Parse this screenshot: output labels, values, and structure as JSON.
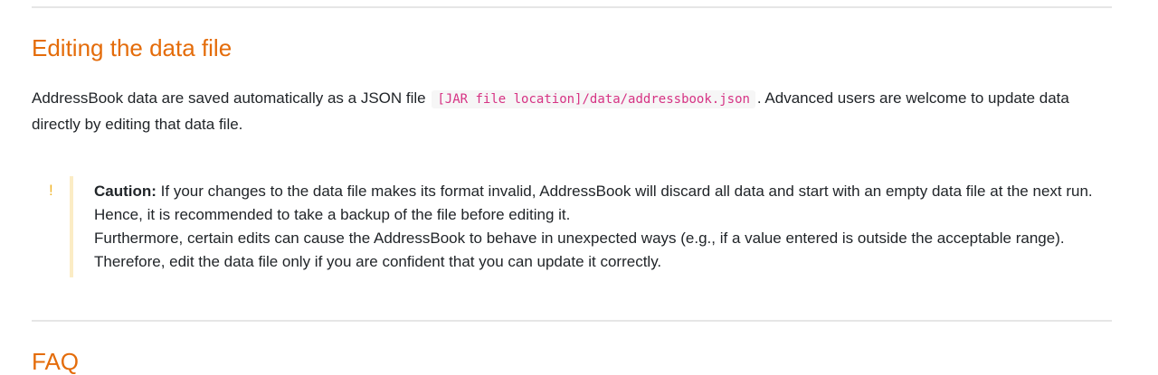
{
  "sections": {
    "editing": {
      "title": "Editing the data file",
      "paragraph": {
        "before_code": "AddressBook data are saved automatically as a JSON file ",
        "code": "[JAR file location]/data/addressbook.json",
        "after_code": ". Advanced users are welcome to update data directly by editing that data file."
      },
      "caution": {
        "icon": "exclamation-icon",
        "label": "Caution:",
        "line1": " If your changes to the data file makes its format invalid, AddressBook will discard all data and start with an empty data file at the next run. Hence, it is recommended to take a backup of the file before editing it.",
        "line2": "Furthermore, certain edits can cause the AddressBook to behave in unexpected ways (e.g., if a value entered is outside the acceptable range). Therefore, edit the data file only if you are confident that you can update it correctly."
      }
    },
    "faq": {
      "title": "FAQ"
    }
  },
  "colors": {
    "heading": "#e46c0a",
    "code_text": "#d63384",
    "caution_icon": "#f0b429",
    "caution_bar": "#fbecc5"
  },
  "icons": {
    "caution_glyph": "!"
  }
}
